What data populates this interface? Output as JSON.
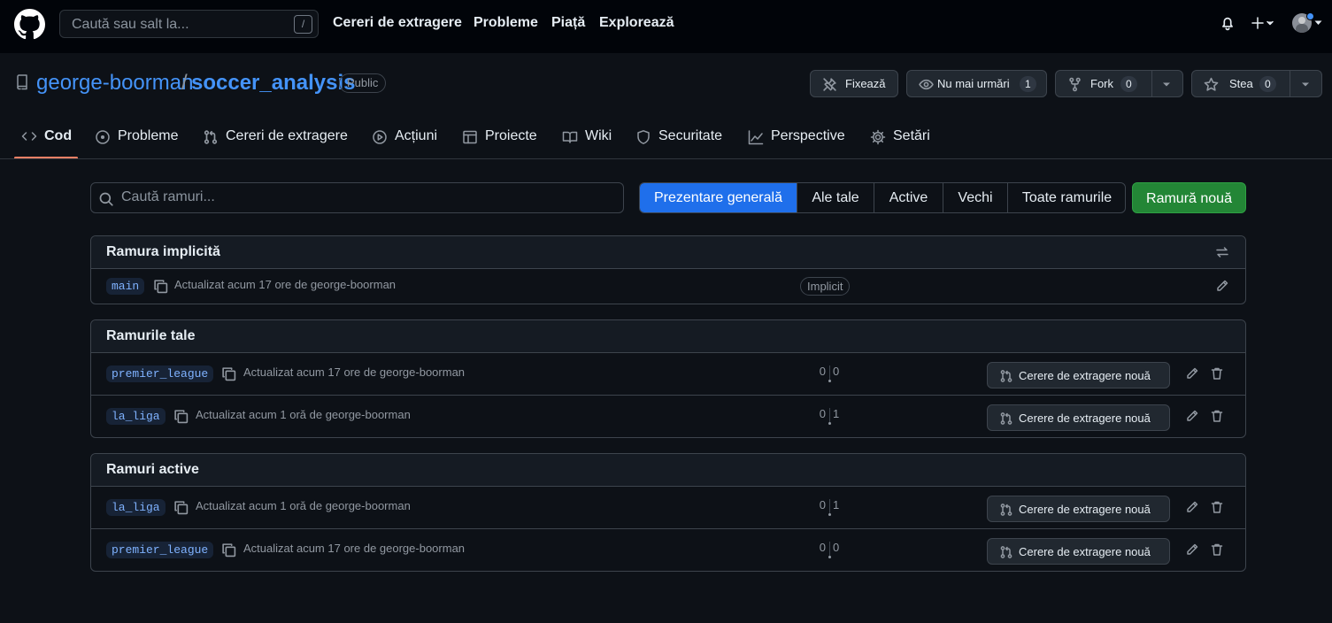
{
  "header": {
    "search_placeholder": "Caută sau salt la...",
    "search_shortcut": "/",
    "nav": [
      "Cereri de extragere",
      "Probleme",
      "Piață",
      "Explorează"
    ]
  },
  "repo": {
    "owner": "george-boorman",
    "separator": "/",
    "name": "soccer_analysis",
    "visibility": "Public",
    "pin_label": "Fixează",
    "watch_label": "Nu mai urmări",
    "watch_count": "1",
    "fork_label": "Fork",
    "fork_count": "0",
    "star_label": "Stea",
    "star_count": "0"
  },
  "tabs": [
    {
      "label": "Cod",
      "icon": "code-icon"
    },
    {
      "label": "Probleme",
      "icon": "issue-icon"
    },
    {
      "label": "Cereri de extragere",
      "icon": "pull-request-icon"
    },
    {
      "label": "Acțiuni",
      "icon": "play-icon"
    },
    {
      "label": "Proiecte",
      "icon": "table-icon"
    },
    {
      "label": "Wiki",
      "icon": "book-icon"
    },
    {
      "label": "Securitate",
      "icon": "shield-icon"
    },
    {
      "label": "Perspective",
      "icon": "graph-icon"
    },
    {
      "label": "Setări",
      "icon": "gear-icon"
    }
  ],
  "filters": {
    "search_placeholder": "Caută ramuri...",
    "options": [
      "Prezentare generală",
      "Ale tale",
      "Active",
      "Vechi",
      "Toate ramurile"
    ],
    "selected": "Prezentare generală",
    "new_branch": "Ramură nouă"
  },
  "default_section": {
    "title": "Ramura implicită",
    "branch": "main",
    "updated": "Actualizat acum 17 ore de george-boorman",
    "badge": "Implicit"
  },
  "pr_button_label": "Cerere de extragere nouă",
  "sections": [
    {
      "title": "Ramurile tale",
      "rows": [
        {
          "branch": "premier_league",
          "updated": "Actualizat acum 17 ore de george-boorman",
          "behind": "0",
          "ahead": "0"
        },
        {
          "branch": "la_liga",
          "updated": "Actualizat acum 1 oră de george-boorman",
          "behind": "0",
          "ahead": "1"
        }
      ]
    },
    {
      "title": "Ramuri active",
      "rows": [
        {
          "branch": "la_liga",
          "updated": "Actualizat acum 1 oră de george-boorman",
          "behind": "0",
          "ahead": "1"
        },
        {
          "branch": "premier_league",
          "updated": "Actualizat acum 17 ore de george-boorman",
          "behind": "0",
          "ahead": "0"
        }
      ]
    }
  ],
  "colors": {
    "background": "#0d1117",
    "header_background": "#010409",
    "accent_blue": "#1f6feb",
    "link_blue": "#4493f8",
    "success_green": "#238636",
    "tab_underline": "#f78166"
  }
}
